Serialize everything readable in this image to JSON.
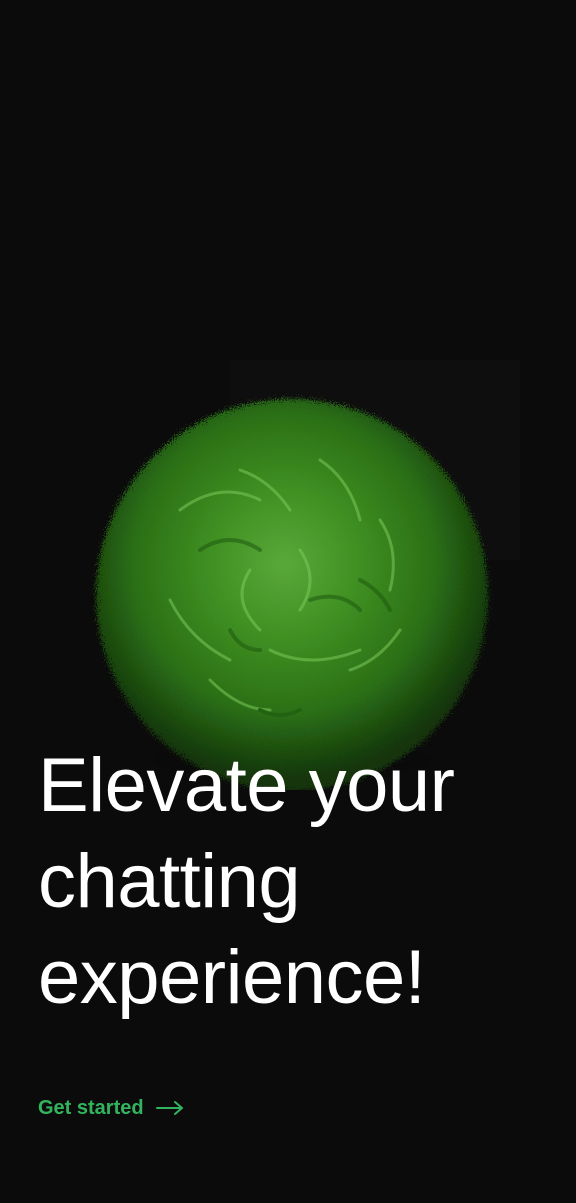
{
  "onboarding": {
    "hero": {
      "image_name": "green-fluffy-ball"
    },
    "headline": {
      "lines": [
        "Elevate your",
        "chatting",
        "experience!"
      ]
    },
    "cta": {
      "label": "Get started",
      "icon": "arrow-right-icon"
    }
  },
  "colors": {
    "background": "#0b0b0b",
    "headline": "#ffffff",
    "accent": "#33b35e",
    "ball_primary": "#2f7d19",
    "ball_highlight": "#5aa83a"
  }
}
